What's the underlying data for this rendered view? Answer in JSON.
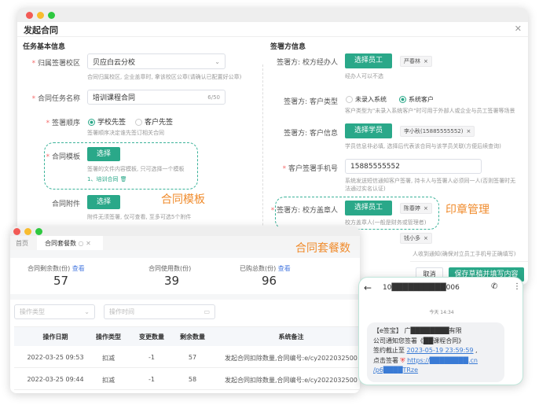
{
  "main_window": {
    "title": "发起合同",
    "close_icon": "close-icon",
    "left": {
      "section": "任务基本信息",
      "campus_label": "归属签署校区",
      "campus_value": "贝应白云分校",
      "campus_help": "合同归属校区, 企业盖章时, 拿该校区公章(请确认已配置好公章)",
      "name_label": "合同任务名称",
      "name_value": "培训课程合同",
      "name_count": "6/50",
      "order_label": "签署顺序",
      "order_opt1": "学校先签",
      "order_opt2": "客户先签",
      "order_help": "签署顺序决定谁先签订相关合同",
      "template_label": "合同模板",
      "template_btn": "选择",
      "template_help": "签署的文件内容模板, 只可选择一个模板",
      "template_item": "1、培训合同",
      "attach_label": "合同附件",
      "attach_btn": "选择",
      "attach_help": "附件无须签署, 仅可查看, 至多可选5个附件"
    },
    "right": {
      "section": "签署方信息",
      "agent_label": "签署方: 校方经办人",
      "agent_btn": "选择员工",
      "agent_tag": "严春林",
      "agent_help": "经办人可以不选",
      "ctype_label": "签署方: 客户类型",
      "ctype_opt1": "未录入系统",
      "ctype_opt2": "系统客户",
      "ctype_help": "客户类型为\"未录入系统客户\"时可用于外部人或企业与员工签署等场景",
      "cinfo_label": "签署方: 客户信息",
      "cinfo_btn": "选择学员",
      "cinfo_tag": "李小秋(15885555552)",
      "cinfo_help": "学员信息非必填, 选择后代表该合同与该学员关联(方便后续查询)",
      "phone_label": "客户签署手机号",
      "phone_value": "15885555552",
      "phone_help1": "系统发送短信通知客户签署, 持卡人与签署人必须同一人(否则签署时无",
      "phone_help2": "法通过实名认证)",
      "seal_label": "签署方: 校方盖章人",
      "seal_btn": "选择员工",
      "seal_tag": "陈春婷",
      "seal_help": "校方盖章人(一般是财务或管理者)",
      "extra_tag": "钱小多",
      "extra_help": "人收到通知(确保对立员工手机号正确填写)",
      "cancel": "取消",
      "save": "保存草稿并填写内容"
    }
  },
  "annotations": {
    "template": "合同模板",
    "seal": "印章管理",
    "package": "合同套餐数"
  },
  "package_window": {
    "tabs": [
      "首页",
      "合同套餐数"
    ],
    "stats": [
      {
        "label": "合同剩余数(份)",
        "value": "57",
        "link": "查看"
      },
      {
        "label": "合同使用数(份)",
        "value": "39"
      },
      {
        "label": "已购总数(份)",
        "value": "96",
        "link": "查看"
      }
    ],
    "filter_type": "操作类型",
    "filter_time": "操作时间",
    "columns": [
      "操作日期",
      "操作类型",
      "变更数量",
      "剩余数量",
      "系统备注"
    ],
    "rows": [
      [
        "2022-03-25 09:53",
        "扣减",
        "-1",
        "57",
        "发起合同扣除数量,合同编号:e/cy2022032500"
      ],
      [
        "2022-03-25 09:44",
        "扣减",
        "-1",
        "58",
        "发起合同扣除数量,合同编号:e/cy2022032500"
      ]
    ]
  },
  "sms": {
    "sender": "10██████████006",
    "time": "今天 14:34",
    "line1": "【e签宝】 广████████有限",
    "line2": "公司通知您签署《██课程合同》",
    "line3a": "签约截止至 ",
    "date": "2023-05-19 23:59:59",
    "line3b": " ,",
    "line4": "点击签署 ",
    "link1": "https://████████.cn",
    "link2": "/p6████TRze"
  },
  "colors": {
    "accent": "#2aa889",
    "annotation": "#f08b2c"
  }
}
